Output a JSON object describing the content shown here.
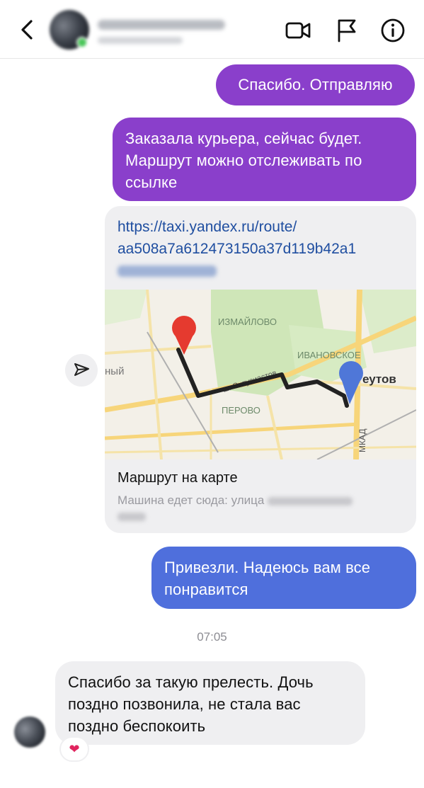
{
  "header": {
    "contact_name": "",
    "contact_status": "",
    "icons": [
      "back-chevron-icon",
      "video-call-icon",
      "flag-icon",
      "info-icon"
    ]
  },
  "messages": [
    {
      "id": "m1",
      "from": "me",
      "text": "Спасибо. Отправляю"
    },
    {
      "id": "m2",
      "from": "me",
      "text": "Заказала курьера, сейчас будет. Маршрут можно отслеживать по ссылке"
    },
    {
      "id": "m4",
      "from": "me",
      "text": "Привезли. Надеюсь вам все понравится"
    },
    {
      "id": "m5",
      "from": "other",
      "text": "Спасибо за такую прелесть. Дочь поздно позвонила, не стала вас поздно беспокоить"
    }
  ],
  "link_card": {
    "url_line1": "https://taxi.yandex.ru/route/",
    "url_line2": "aa508a7a612473150a37d119b42a1",
    "title": "Маршрут на карте",
    "subtitle": "Машина едет сюда: улица"
  },
  "map": {
    "labels": {
      "izmaylovo": "ИЗМАЙЛОВО",
      "ivanovskoe": "ИВАНОВСКОЕ",
      "reutov": "еутов",
      "perovo": "ПЕРОВО",
      "mkad": "МКАД",
      "road": "ш. Энтузиастов",
      "left_edge": "ный"
    }
  },
  "timestamp": "07:05",
  "reaction": "heart",
  "colors": {
    "purple_bubble": "#8a3fcb",
    "blue_bubble": "#4f6fdc",
    "gray_bubble": "#efeff1",
    "link": "#1f4ea0"
  }
}
